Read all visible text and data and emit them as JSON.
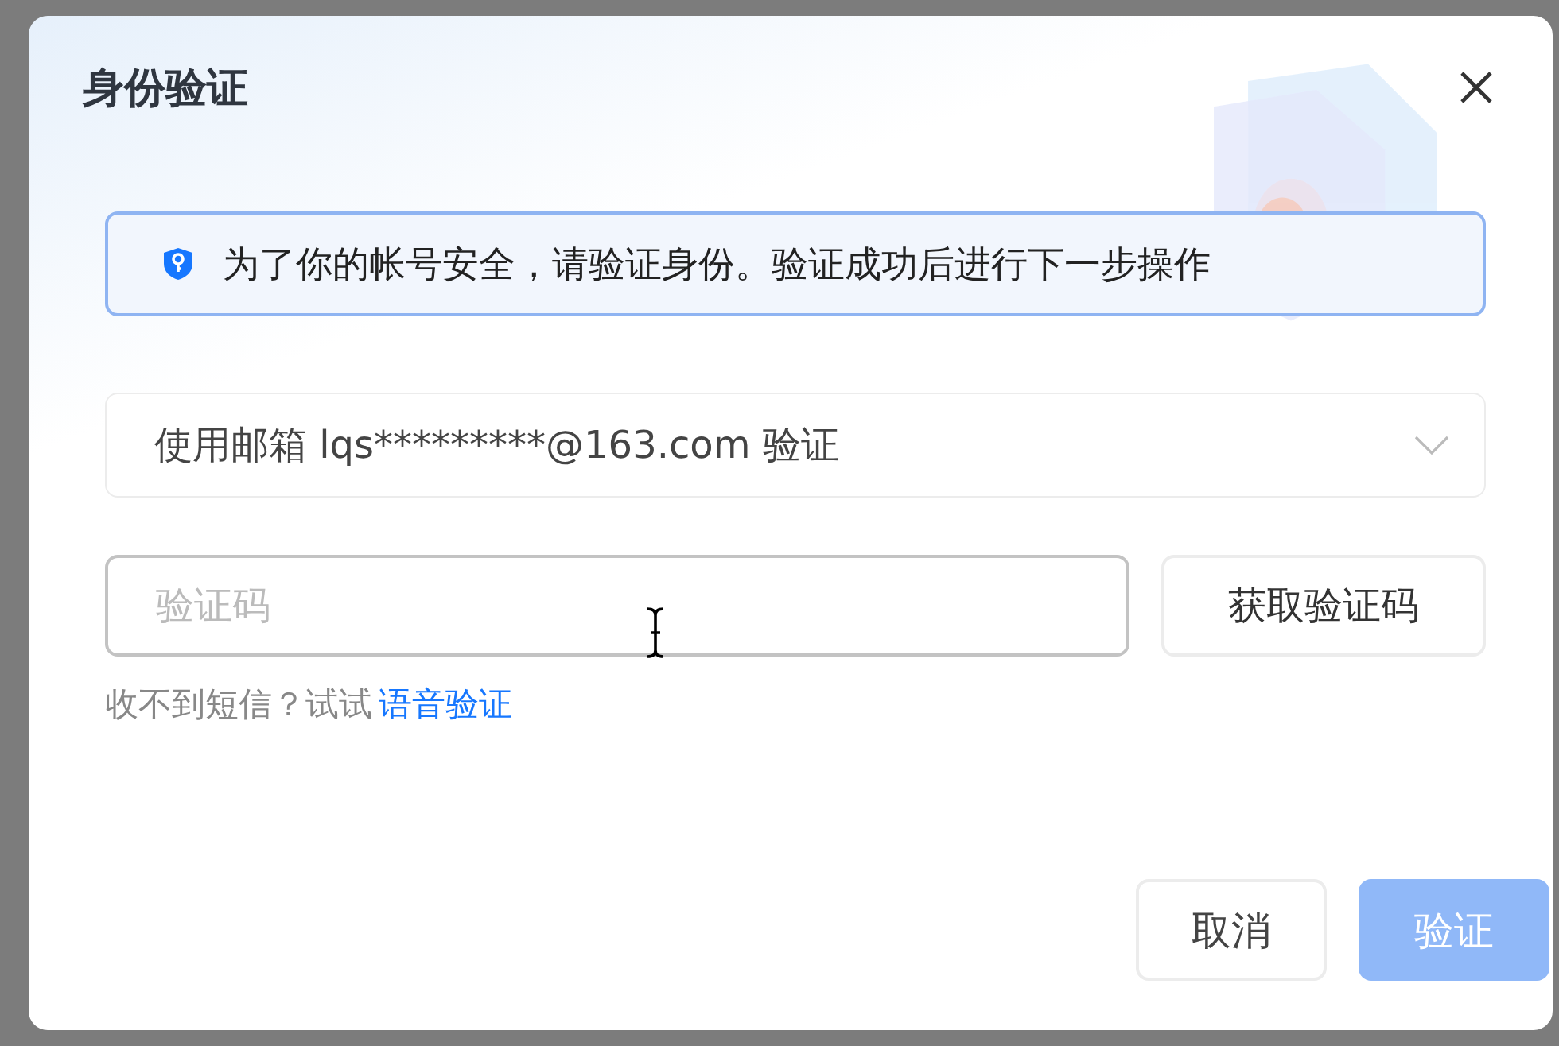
{
  "dialog": {
    "title": "身份验证",
    "notice": "为了你的帐号安全，请验证身份。验证成功后进行下一步操作",
    "method_select": {
      "value": "使用邮箱 lqs*********@163.com 验证"
    },
    "code_field": {
      "placeholder": "验证码"
    },
    "get_code_button": "获取验证码",
    "hint": {
      "text": "收不到短信？试试",
      "link": "语音验证"
    },
    "buttons": [
      {
        "label": "取消",
        "kind": "secondary",
        "disabled": false
      },
      {
        "label": "验证",
        "kind": "primary",
        "disabled": true
      }
    ]
  }
}
